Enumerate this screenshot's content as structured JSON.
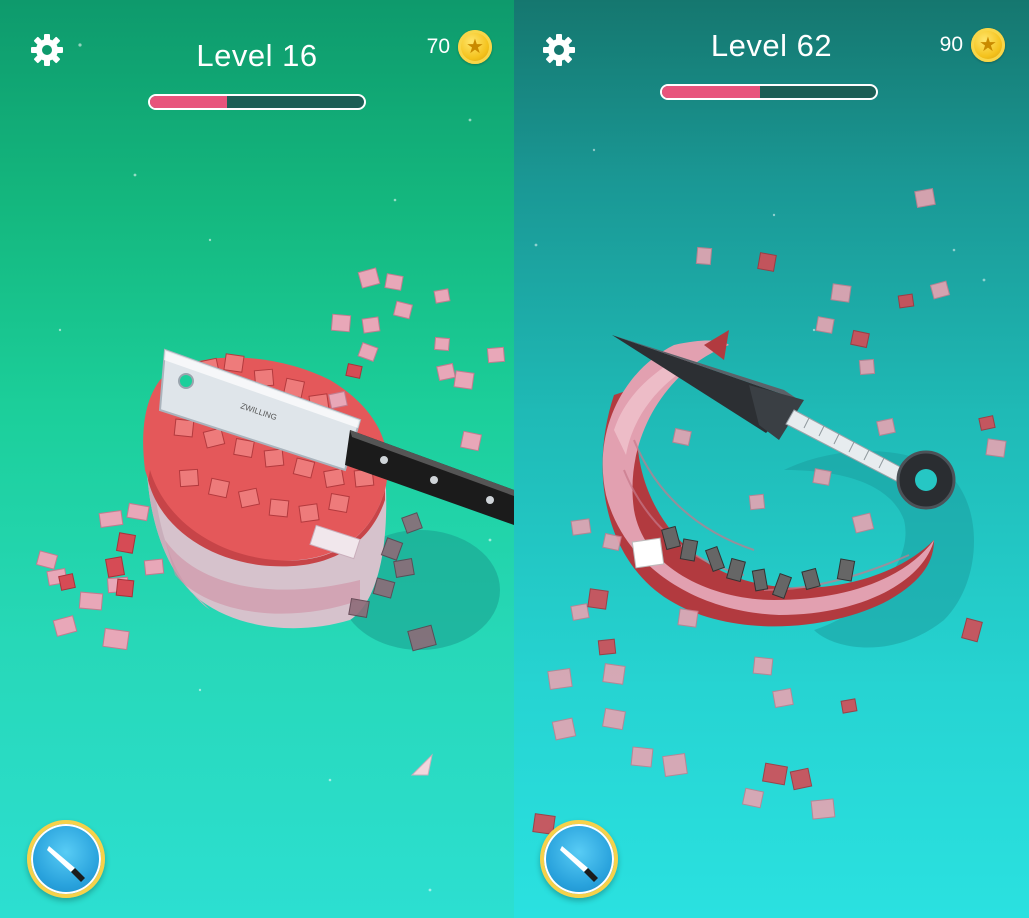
{
  "screens": [
    {
      "level_label": "Level 16",
      "progress": 0.36,
      "coins": "70",
      "icons": {
        "settings": "gear-icon",
        "coin": "star-coin-icon",
        "knife_button": "knife-icon"
      },
      "object": "meat block",
      "blade": "cleaver",
      "blade_engraving": "ZWILLING"
    },
    {
      "level_label": "Level 62",
      "progress": 0.46,
      "coins": "90",
      "icons": {
        "settings": "gear-icon",
        "coin": "star-coin-icon",
        "knife_button": "knife-icon"
      },
      "object": "crescent meat slab",
      "blade": "kunai"
    }
  ],
  "colors": {
    "left_bg_top": "#0e9a6c",
    "left_bg_bottom": "#2cdfd1",
    "right_bg_top": "#15776f",
    "right_bg_bottom": "#2ae1e0",
    "progress_fill": "#e8547c",
    "progress_track": "#1c5f55",
    "coin_gold": "#f4c21d",
    "button_blue": "#2aa3dd",
    "meat_red": "#e4585a"
  }
}
